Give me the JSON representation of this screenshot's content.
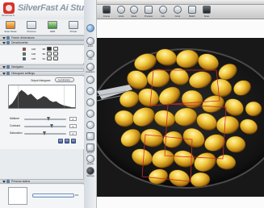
{
  "window": {
    "title": "SilverFast 8.0"
  },
  "brand": {
    "name": "SilverFast",
    "product_suffix": "Ai Studio",
    "sub_label": "SilverFast 8"
  },
  "top_tools": [
    {
      "label": "Scan Mode",
      "icon": "scan-mode-icon"
    },
    {
      "label": "Prescan",
      "icon": "prescan-icon"
    },
    {
      "label": "HDR",
      "icon": "hdr-icon"
    },
    {
      "label": "Printer",
      "icon": "printer-icon"
    }
  ],
  "panels": {
    "frame_dimensions": "Frame dimensions",
    "densitometer": "Densitometer",
    "navigator": "Navigator",
    "histogram": "Histogram settings",
    "prescan": "Prescan status"
  },
  "densitometer": {
    "rows": [
      {
        "color": "#d43a2e",
        "value1": "108",
        "value2": "88"
      },
      {
        "color": "#2f9a3c",
        "value1": "108",
        "value2": "80"
      },
      {
        "color": "#2f5fb3",
        "value1": "108",
        "value2": "62"
      }
    ]
  },
  "histogram": {
    "mode_label": "Output histogram",
    "mode_value": "Luminance",
    "sliders": [
      {
        "label": "Midtone",
        "value": "0",
        "level": 0.55
      },
      {
        "label": "Contrast",
        "value": "0",
        "level": 0.62
      },
      {
        "label": "Saturation",
        "value": "0",
        "level": 0.45
      }
    ]
  },
  "prescan": {
    "percent": "0%"
  },
  "toolbar": [
    {
      "label": "Frame",
      "icon": "frame-icon"
    },
    {
      "label": "Undo",
      "icon": "undo-icon"
    },
    {
      "label": "Redo",
      "icon": "redo-icon"
    },
    {
      "label": "Preview",
      "icon": "preview-icon"
    },
    {
      "label": "Info",
      "icon": "info-icon"
    },
    {
      "label": "Color",
      "icon": "color-icon"
    },
    {
      "label": "Batch",
      "icon": "batch-icon"
    },
    {
      "label": "Scan",
      "icon": "scan-icon"
    }
  ],
  "tools": [
    {
      "label": "",
      "icon": "help-icon"
    },
    {
      "label": "Zoom",
      "icon": "zoom-icon"
    },
    {
      "label": "Auto",
      "icon": "auto-adjust-icon"
    },
    {
      "label": "Gradation",
      "icon": "gradation-icon"
    },
    {
      "label": "",
      "icon": "global-color-icon"
    },
    {
      "label": "",
      "icon": "selective-color-icon"
    },
    {
      "label": "",
      "icon": "sharpen-icon"
    },
    {
      "label": "",
      "icon": "dust-scratch-icon"
    },
    {
      "label": "",
      "icon": "grain-icon"
    },
    {
      "label": "",
      "icon": "color-restore-icon"
    },
    {
      "label": "Expert",
      "icon": "expert-icon"
    },
    {
      "label": "Pipette",
      "icon": "pipette-icon"
    },
    {
      "label": "Settings",
      "icon": "settings-icon"
    }
  ],
  "colors": {
    "accent": "#2d7fd8",
    "frame": "#cc2a2a",
    "panel": "#e9ecef"
  }
}
